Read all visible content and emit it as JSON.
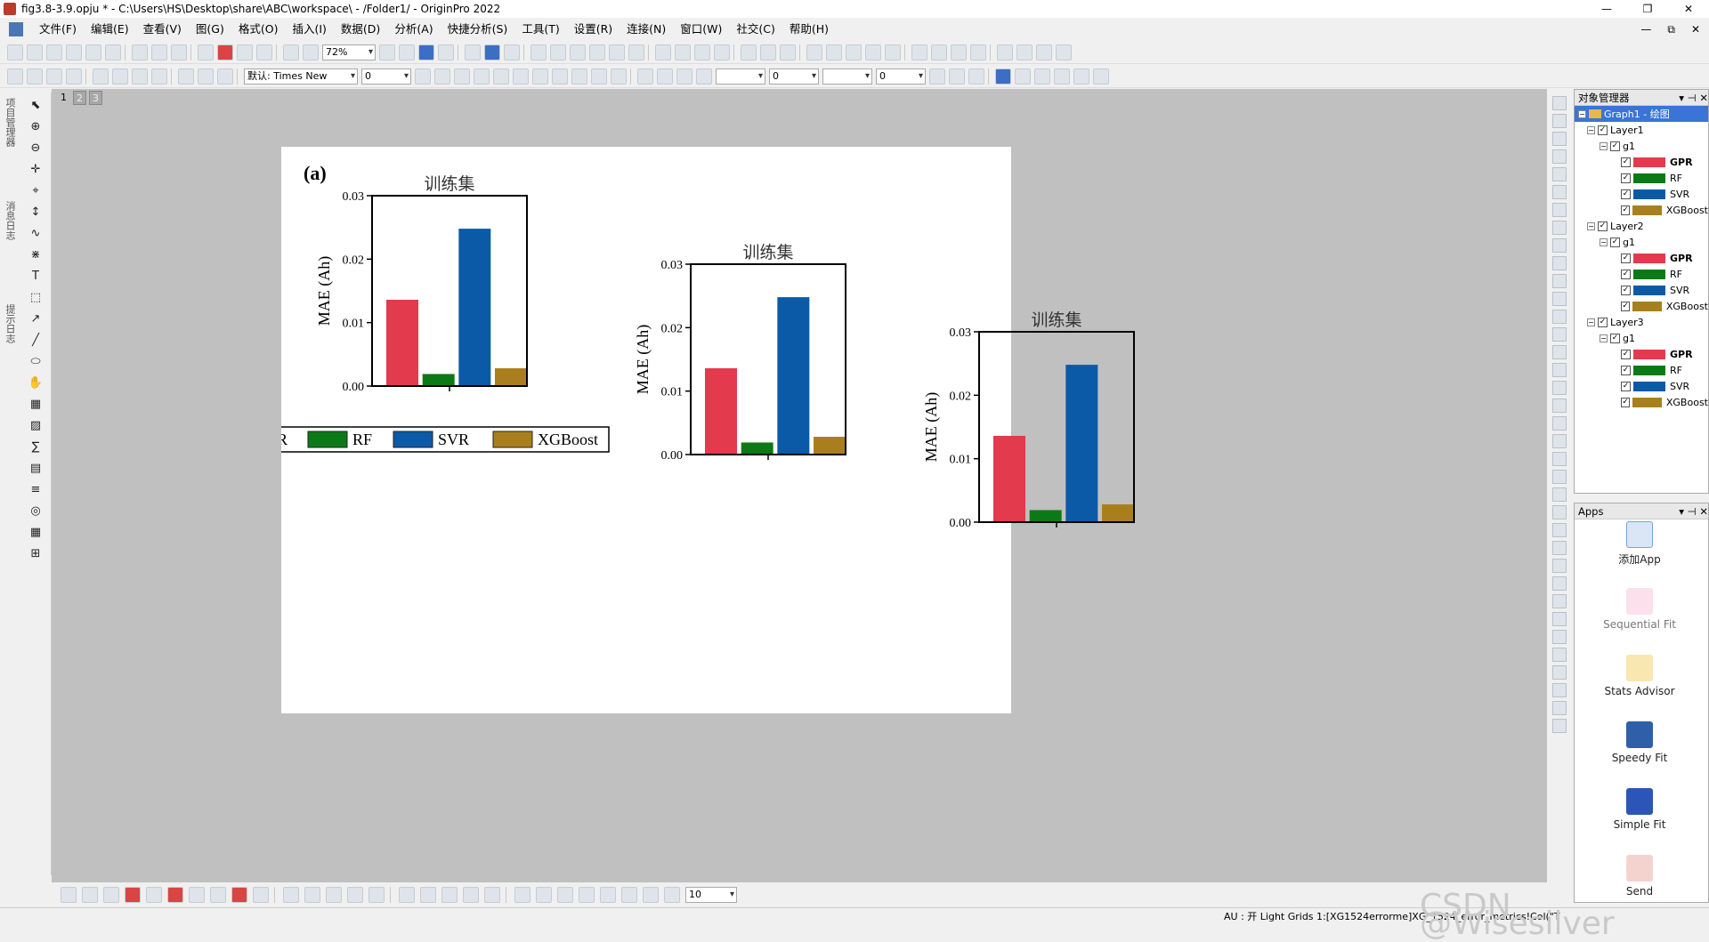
{
  "window": {
    "title": "fig3.8-3.9.opju * - C:\\Users\\HS\\Desktop\\share\\ABC\\workspace\\ - /Folder1/ - OriginPro 2022",
    "controls": [
      "—",
      "❐",
      "✕"
    ]
  },
  "menu": {
    "items": [
      "文件(F)",
      "编辑(E)",
      "查看(V)",
      "图(G)",
      "格式(O)",
      "插入(I)",
      "数据(D)",
      "分析(A)",
      "快捷分析(S)",
      "工具(T)",
      "设置(R)",
      "连接(N)",
      "窗口(W)",
      "社交(C)",
      "帮助(H)"
    ],
    "mdi_controls": [
      "—",
      "⧉",
      "✕"
    ]
  },
  "toolbar": {
    "zoom": "72%",
    "font": "默认: Times New",
    "font_size": "0",
    "line_width": "0",
    "border_width": "0",
    "bottom_size": "10"
  },
  "left_tabs": [
    "项目管理器",
    "消息日志",
    "提示日志"
  ],
  "page_tabs": [
    "1",
    "2",
    "3"
  ],
  "graph": {
    "panel_label": "(a)",
    "legend": [
      {
        "name": "GPR",
        "color": "#e33a4e"
      },
      {
        "name": "RF",
        "color": "#0b7a16"
      },
      {
        "name": "SVR",
        "color": "#0b5aa8"
      },
      {
        "name": "XGBoost",
        "color": "#a97f1d"
      }
    ]
  },
  "chart_data": [
    {
      "type": "bar",
      "title": "训练集",
      "ylabel": "MAE (Ah)",
      "categories": [
        "GPR",
        "RF",
        "SVR",
        "XGBoost"
      ],
      "values": [
        0.0136,
        0.0019,
        0.0248,
        0.0028
      ],
      "ylim": [
        0,
        0.03
      ],
      "yticks": [
        "0.00",
        "0.01",
        "0.02",
        "0.03"
      ],
      "colors": [
        "#e33a4e",
        "#0b7a16",
        "#0b5aa8",
        "#a97f1d"
      ]
    },
    {
      "type": "bar",
      "title": "训练集",
      "ylabel": "MAE (Ah)",
      "categories": [
        "GPR",
        "RF",
        "SVR",
        "XGBoost"
      ],
      "values": [
        0.0136,
        0.0019,
        0.0248,
        0.0028
      ],
      "ylim": [
        0,
        0.03
      ],
      "yticks": [
        "0.00",
        "0.01",
        "0.02",
        "0.03"
      ],
      "colors": [
        "#e33a4e",
        "#0b7a16",
        "#0b5aa8",
        "#a97f1d"
      ]
    },
    {
      "type": "bar",
      "title": "训练集",
      "ylabel": "MAE (Ah)",
      "categories": [
        "GPR",
        "RF",
        "SVR",
        "XGBoost"
      ],
      "values": [
        0.0136,
        0.0019,
        0.0248,
        0.0028
      ],
      "ylim": [
        0,
        0.03
      ],
      "yticks": [
        "0.00",
        "0.01",
        "0.02",
        "0.03"
      ],
      "colors": [
        "#e33a4e",
        "#0b7a16",
        "#0b5aa8",
        "#a97f1d"
      ]
    }
  ],
  "object_manager": {
    "title": "对象管理器",
    "root": "Graph1 - 绘图",
    "layers": [
      {
        "name": "Layer1",
        "group": "g1"
      },
      {
        "name": "Layer2",
        "group": "g1"
      },
      {
        "name": "Layer3",
        "group": "g1"
      }
    ],
    "plots": [
      "GPR",
      "RF",
      "SVR",
      "XGBoost"
    ]
  },
  "apps": {
    "title": "Apps",
    "items": [
      "添加App",
      "Sequential Fit",
      "Stats Advisor",
      "Speedy Fit",
      "Simple Fit",
      "Send"
    ]
  },
  "status": {
    "text": "AU : 开  Light Grids  1:[XG1524errorme]XG_1524_error_metrics!Col(\"T",
    "watermark": "CSDN @Wisesilver"
  }
}
